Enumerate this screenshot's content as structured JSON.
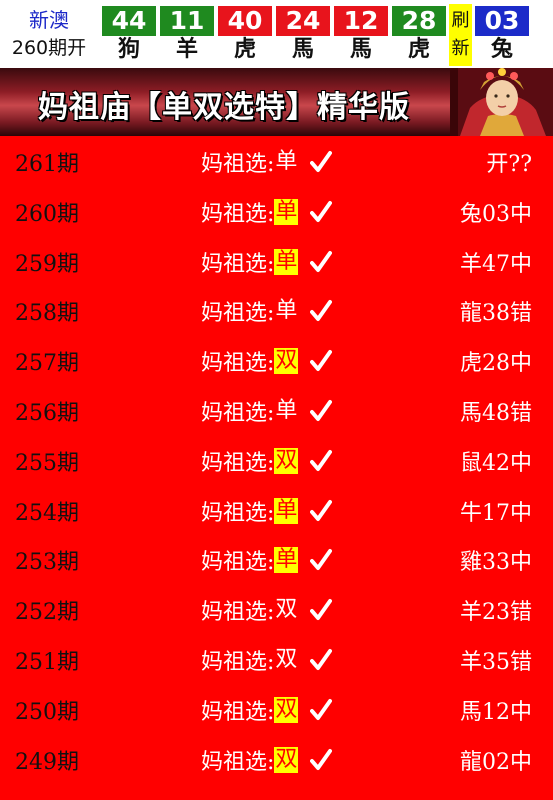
{
  "header": {
    "region": "新澳",
    "period_open": "260期开",
    "balls": [
      {
        "num": "44",
        "zodiac": "狗",
        "color": "#1f8a1f"
      },
      {
        "num": "11",
        "zodiac": "羊",
        "color": "#1f8a1f"
      },
      {
        "num": "40",
        "zodiac": "虎",
        "color": "#e8141c"
      },
      {
        "num": "24",
        "zodiac": "馬",
        "color": "#e8141c"
      },
      {
        "num": "12",
        "zodiac": "馬",
        "color": "#e8141c"
      },
      {
        "num": "28",
        "zodiac": "虎",
        "color": "#1f8a1f"
      }
    ],
    "refresh": [
      "刷",
      "新"
    ],
    "special": {
      "num": "03",
      "zodiac": "兔",
      "color": "#1c2bc9"
    }
  },
  "banner": {
    "title": "妈祖庙【单双选特】精华版"
  },
  "rows": [
    {
      "period": "261期",
      "label": "妈祖选:",
      "pick": "单",
      "highlight": false,
      "result": "开??"
    },
    {
      "period": "260期",
      "label": "妈祖选:",
      "pick": "单",
      "highlight": true,
      "result": "兔03中"
    },
    {
      "period": "259期",
      "label": "妈祖选:",
      "pick": "单",
      "highlight": true,
      "result": "羊47中"
    },
    {
      "period": "258期",
      "label": "妈祖选:",
      "pick": "单",
      "highlight": false,
      "result": "龍38错"
    },
    {
      "period": "257期",
      "label": "妈祖选:",
      "pick": "双",
      "highlight": true,
      "result": "虎28中"
    },
    {
      "period": "256期",
      "label": "妈祖选:",
      "pick": "单",
      "highlight": false,
      "result": "馬48错"
    },
    {
      "period": "255期",
      "label": "妈祖选:",
      "pick": "双",
      "highlight": true,
      "result": "鼠42中"
    },
    {
      "period": "254期",
      "label": "妈祖选:",
      "pick": "单",
      "highlight": true,
      "result": "牛17中"
    },
    {
      "period": "253期",
      "label": "妈祖选:",
      "pick": "单",
      "highlight": true,
      "result": "雞33中"
    },
    {
      "period": "252期",
      "label": "妈祖选:",
      "pick": "双",
      "highlight": false,
      "result": "羊23错"
    },
    {
      "period": "251期",
      "label": "妈祖选:",
      "pick": "双",
      "highlight": false,
      "result": "羊35错"
    },
    {
      "period": "250期",
      "label": "妈祖选:",
      "pick": "双",
      "highlight": true,
      "result": "馬12中"
    },
    {
      "period": "249期",
      "label": "妈祖选:",
      "pick": "双",
      "highlight": true,
      "result": "龍02中"
    }
  ],
  "icons": {
    "check": "check-icon",
    "goddess": "mazu-portrait"
  }
}
